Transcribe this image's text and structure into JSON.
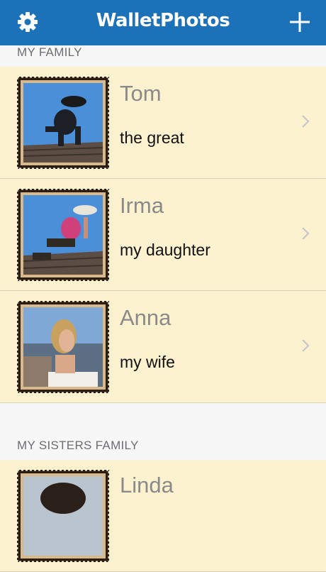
{
  "app": {
    "title": "WalletPhotos"
  },
  "navbar": {
    "settings_icon": "gear-icon",
    "add_icon": "plus-icon"
  },
  "sections": [
    {
      "header": "MY FAMILY",
      "rows": [
        {
          "name": "Tom",
          "description": "the great"
        },
        {
          "name": "Irma",
          "description": "my daughter"
        },
        {
          "name": "Anna",
          "description": "my wife"
        }
      ]
    },
    {
      "header": "MY SISTERS FAMILY",
      "rows": [
        {
          "name": "Linda",
          "description": ""
        }
      ]
    }
  ],
  "colors": {
    "nav": "#1b72b9",
    "row_bg": "#fdf2cf",
    "header_bg": "#f7f7f7"
  }
}
